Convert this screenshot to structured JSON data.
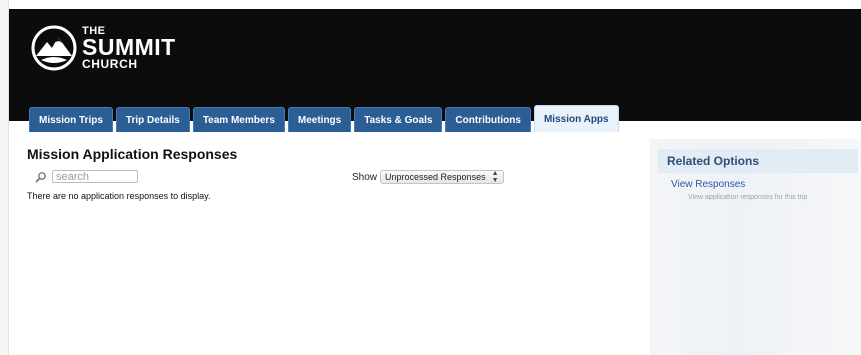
{
  "header": {
    "logo": {
      "line1": "THE",
      "line2": "SUMMIT",
      "line3": "CHURCH"
    },
    "background_color": "#0c0c0c"
  },
  "tabs": [
    {
      "label": "Mission Trips",
      "active": false
    },
    {
      "label": "Trip Details",
      "active": false
    },
    {
      "label": "Team Members",
      "active": false
    },
    {
      "label": "Meetings",
      "active": false
    },
    {
      "label": "Tasks & Goals",
      "active": false
    },
    {
      "label": "Contributions",
      "active": false
    },
    {
      "label": "Mission Apps",
      "active": true
    }
  ],
  "main": {
    "title": "Mission Application Responses",
    "search": {
      "placeholder": "search",
      "value": "",
      "icon": "search-icon"
    },
    "show": {
      "label": "Show",
      "selected": "Unprocessed Responses"
    },
    "empty_message": "There are no application responses to display."
  },
  "sidebar": {
    "title": "Related Options",
    "link_label": "View Responses",
    "link_description": "View application responses for this trip"
  },
  "colors": {
    "tab_blue": "#2c5e96",
    "tab_active_bg": "#e9f1fb",
    "link_blue": "#2a5aa8",
    "sidebar_header_bg": "#e3ebf4"
  }
}
